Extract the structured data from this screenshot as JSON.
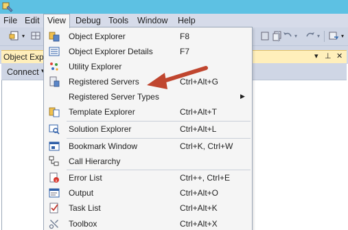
{
  "colors": {
    "accent_arrow": "#c0462f",
    "titlebar": "#5dc1e3",
    "panel_header": "#ffefbb"
  },
  "menubar": [
    {
      "label": "File"
    },
    {
      "label": "Edit"
    },
    {
      "label": "View"
    },
    {
      "label": "Debug"
    },
    {
      "label": "Tools"
    },
    {
      "label": "Window"
    },
    {
      "label": "Help"
    }
  ],
  "panel": {
    "title": "Object Expl",
    "pin_label": "↕",
    "close_label": "✕",
    "connect_label": "Connect"
  },
  "view_menu": {
    "items": [
      {
        "label": "Object Explorer",
        "shortcut": "F8",
        "icon": "object-explorer-icon"
      },
      {
        "label": "Object Explorer Details",
        "shortcut": "F7",
        "icon": "details-list-icon"
      },
      {
        "label": "Utility Explorer",
        "shortcut": "",
        "icon": "utility-explorer-icon"
      },
      {
        "label": "Registered Servers",
        "shortcut": "Ctrl+Alt+G",
        "icon": "registered-servers-icon"
      },
      {
        "label": "Registered Server Types",
        "shortcut": "",
        "icon": "",
        "submenu": true
      },
      {
        "label": "Template Explorer",
        "shortcut": "Ctrl+Alt+T",
        "icon": "template-explorer-icon"
      },
      {
        "label": "Solution Explorer",
        "shortcut": "Ctrl+Alt+L",
        "icon": "solution-explorer-icon"
      },
      {
        "label": "Bookmark Window",
        "shortcut": "Ctrl+K, Ctrl+W",
        "icon": "bookmark-icon"
      },
      {
        "label": "Call Hierarchy",
        "shortcut": "",
        "icon": "call-hierarchy-icon"
      },
      {
        "label": "Error List",
        "shortcut": "Ctrl++, Ctrl+E",
        "icon": "error-list-icon"
      },
      {
        "label": "Output",
        "shortcut": "Ctrl+Alt+O",
        "icon": "output-icon"
      },
      {
        "label": "Task List",
        "shortcut": "Ctrl+Alt+K",
        "icon": "task-list-icon"
      },
      {
        "label": "Toolbox",
        "shortcut": "Ctrl+Alt+X",
        "icon": "toolbox-icon"
      }
    ]
  }
}
